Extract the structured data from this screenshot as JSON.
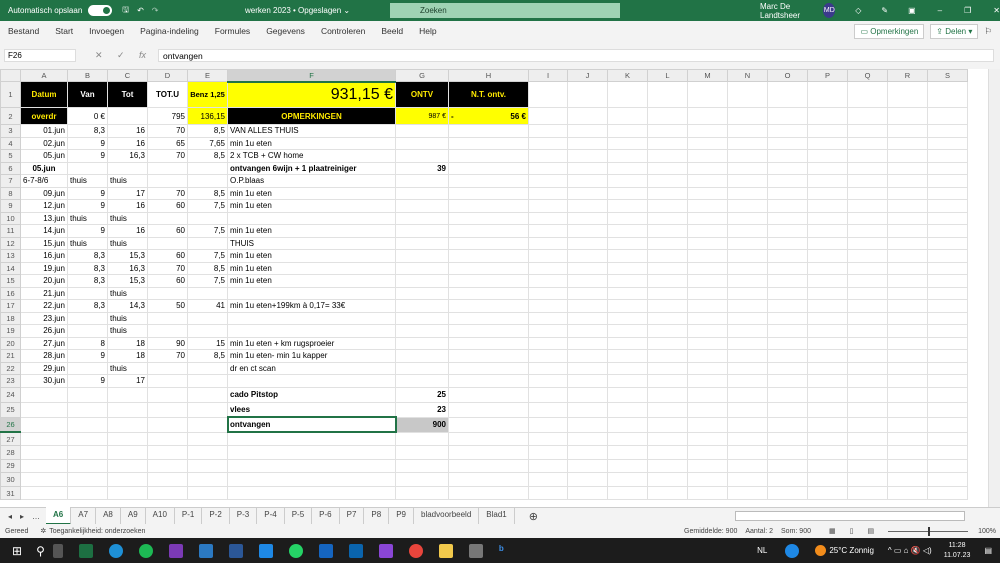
{
  "titlebar": {
    "autosave": "Automatisch opslaan",
    "doc_title": "werken 2023 • Opgeslagen ⌄",
    "search_placeholder": "Zoeken",
    "user": "Marc De Landtsheer",
    "initials": "MD"
  },
  "menu": {
    "items": [
      "Bestand",
      "Start",
      "Invoegen",
      "Pagina-indeling",
      "Formules",
      "Gegevens",
      "Controleren",
      "Beeld",
      "Help"
    ],
    "comments": "Opmerkingen",
    "share": "Delen"
  },
  "formula_bar": {
    "name_box": "F26",
    "fx": "fx",
    "value": "ontvangen"
  },
  "columns": [
    "A",
    "B",
    "C",
    "D",
    "E",
    "F",
    "G",
    "H",
    "I",
    "J",
    "K",
    "L",
    "M",
    "N",
    "O",
    "P",
    "Q",
    "R",
    "S"
  ],
  "rows": [
    [
      "Datum",
      "Van",
      "Tot",
      "TOT.U",
      "Benz 1,25",
      "931,15 €",
      "ONTV",
      "N.T. ontv."
    ],
    [
      "overdr",
      "0 €",
      "",
      "795",
      "136,15",
      "OPMERKINGEN",
      "987 €",
      "56 €"
    ],
    [
      "01.jun",
      "8,3",
      "16",
      "70",
      "8,5",
      "VAN ALLES THUIS",
      "",
      ""
    ],
    [
      "02.jun",
      "9",
      "16",
      "65",
      "7,65",
      "min 1u eten",
      "",
      ""
    ],
    [
      "05.jun",
      "9",
      "16,3",
      "70",
      "8,5",
      "2 x TCB + CW home",
      "",
      ""
    ],
    [
      "05.jun",
      "",
      "",
      "",
      "",
      "ontvangen 6wijn + 1 plaatreiniger",
      "39",
      ""
    ],
    [
      "6-7-8/6",
      "thuis",
      "thuis",
      "",
      "",
      "O.P.blaas",
      "",
      ""
    ],
    [
      "09.jun",
      "9",
      "17",
      "70",
      "8,5",
      "min 1u eten",
      "",
      ""
    ],
    [
      "12.jun",
      "9",
      "16",
      "60",
      "7,5",
      "min 1u eten",
      "",
      ""
    ],
    [
      "13.jun",
      "thuis",
      "thuis",
      "",
      "",
      "",
      "",
      ""
    ],
    [
      "14.jun",
      "9",
      "16",
      "60",
      "7,5",
      "min 1u eten",
      "",
      ""
    ],
    [
      "15.jun",
      "thuis",
      "thuis",
      "",
      "",
      "THUIS",
      "",
      ""
    ],
    [
      "16.jun",
      "8,3",
      "15,3",
      "60",
      "7,5",
      "min 1u eten",
      "",
      ""
    ],
    [
      "19.jun",
      "8,3",
      "16,3",
      "70",
      "8,5",
      "min 1u eten",
      "",
      ""
    ],
    [
      "20.jun",
      "8,3",
      "15,3",
      "60",
      "7,5",
      "min 1u eten",
      "",
      ""
    ],
    [
      "21.jun",
      "",
      "thuis",
      "",
      "",
      "",
      "",
      ""
    ],
    [
      "22.jun",
      "8,3",
      "14,3",
      "50",
      "41",
      "min 1u eten+199km à 0,17= 33€",
      "",
      ""
    ],
    [
      "23.jun",
      "",
      "thuis",
      "",
      "",
      "",
      "",
      ""
    ],
    [
      "26.jun",
      "",
      "thuis",
      "",
      "",
      "",
      "",
      ""
    ],
    [
      "27.jun",
      "8",
      "18",
      "90",
      "15",
      "min 1u eten + km rugsproeier",
      "",
      ""
    ],
    [
      "28.jun",
      "9",
      "18",
      "70",
      "8,5",
      "min 1u eten- min 1u kapper",
      "",
      ""
    ],
    [
      "29.jun",
      "",
      "thuis",
      "",
      "",
      "dr en ct scan",
      "",
      ""
    ],
    [
      "30.jun",
      "9",
      "17",
      "",
      "",
      "",
      "",
      ""
    ],
    [
      "",
      "",
      "",
      "",
      "",
      "cado Pitstop",
      "25",
      ""
    ],
    [
      "",
      "",
      "",
      "",
      "",
      "vlees",
      "23",
      ""
    ],
    [
      "",
      "",
      "",
      "",
      "",
      "ontvangen",
      "900",
      ""
    ],
    [
      "",
      "",
      "",
      "",
      "",
      "",
      "",
      ""
    ],
    [
      "",
      "",
      "",
      "",
      "",
      "",
      "",
      ""
    ],
    [
      "",
      "",
      "",
      "",
      "",
      "",
      "",
      ""
    ],
    [
      "",
      "",
      "",
      "",
      "",
      "",
      "",
      ""
    ],
    [
      "",
      "",
      "",
      "",
      "",
      "",
      "",
      ""
    ]
  ],
  "h2_prefix": "-",
  "sheet_tabs": [
    "A6",
    "A7",
    "A8",
    "A9",
    "A10",
    "P-1",
    "P-2",
    "P-3",
    "P-4",
    "P-5",
    "P-6",
    "P7",
    "P8",
    "P9",
    "bladvoorbeeld",
    "Blad1"
  ],
  "active_tab": "A6",
  "status": {
    "ready": "Gereed",
    "accessibility": "Toegankelijkheid: onderzoeken",
    "average": "Gemiddelde: 900",
    "count": "Aantal: 2",
    "sum": "Som: 900",
    "zoom": "100%"
  },
  "taskbar": {
    "lang": "NL",
    "weather": "25°C  Zonnig",
    "time": "11:28",
    "date": "11.07.23"
  },
  "colors": {
    "excel_green": "#217346",
    "yellow": "#ffff00"
  }
}
